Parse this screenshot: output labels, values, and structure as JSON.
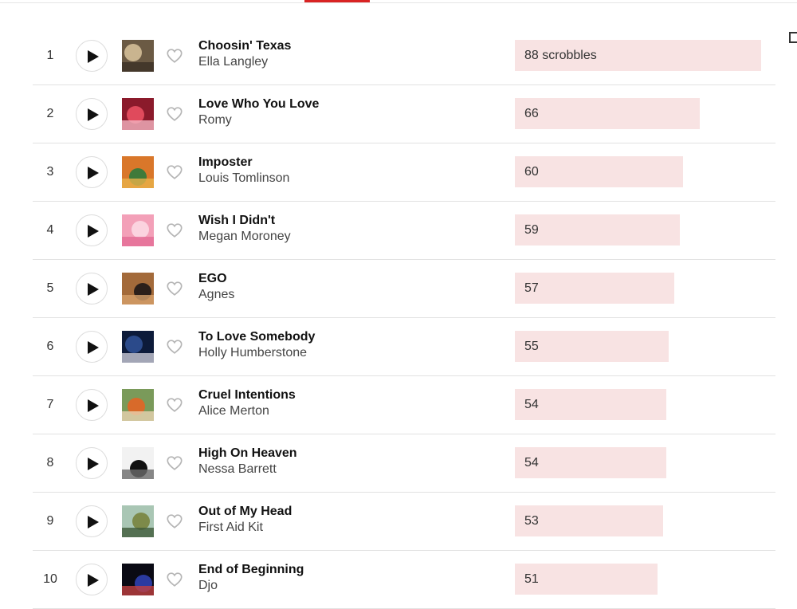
{
  "chart_data": {
    "type": "table",
    "columns": [
      "rank",
      "track",
      "artist",
      "scrobbles"
    ],
    "unit_label": "scrobbles",
    "max": 88,
    "rows": [
      {
        "rank": "1",
        "track": "Choosin' Texas",
        "artist": "Ella Langley",
        "scrobbles": 88,
        "label": "88 scrobbles"
      },
      {
        "rank": "2",
        "track": "Love Who You Love",
        "artist": "Romy",
        "scrobbles": 66,
        "label": "66"
      },
      {
        "rank": "3",
        "track": "Imposter",
        "artist": "Louis Tomlinson",
        "scrobbles": 60,
        "label": "60"
      },
      {
        "rank": "4",
        "track": "Wish I Didn't",
        "artist": "Megan Moroney",
        "scrobbles": 59,
        "label": "59"
      },
      {
        "rank": "5",
        "track": "EGO",
        "artist": "Agnes",
        "scrobbles": 57,
        "label": "57"
      },
      {
        "rank": "6",
        "track": "To Love Somebody",
        "artist": "Holly Humberstone",
        "scrobbles": 55,
        "label": "55"
      },
      {
        "rank": "7",
        "track": "Cruel Intentions",
        "artist": "Alice Merton",
        "scrobbles": 54,
        "label": "54"
      },
      {
        "rank": "8",
        "track": "High On Heaven",
        "artist": "Nessa Barrett",
        "scrobbles": 54,
        "label": "54"
      },
      {
        "rank": "9",
        "track": "Out of My Head",
        "artist": "First Aid Kit",
        "scrobbles": 53,
        "label": "53"
      },
      {
        "rank": "10",
        "track": "End of Beginning",
        "artist": "Djo",
        "scrobbles": 51,
        "label": "51"
      }
    ]
  },
  "colors": {
    "bar_fill": "#f8e3e3",
    "accent": "#d92323",
    "divider": "#e2e2e2"
  },
  "icons": {
    "play": "play-icon",
    "love": "heart-outline-icon",
    "artwork": "album-art"
  },
  "artwork_palettes": [
    [
      "#6b5a44",
      "#c9b48f",
      "#3b2f25"
    ],
    [
      "#8b1a2b",
      "#e04a5c",
      "#f2b3c0"
    ],
    [
      "#d9772a",
      "#3f7a3a",
      "#e8b24a"
    ],
    [
      "#f3a0b8",
      "#fbd3df",
      "#e36c95"
    ],
    [
      "#a36a3a",
      "#2b1f1a",
      "#d6a06a"
    ],
    [
      "#0d1b3a",
      "#2b4a8a",
      "#c9c9d6"
    ],
    [
      "#7a9a5a",
      "#d86a2a",
      "#e8d2b0"
    ],
    [
      "#f2f2f2",
      "#111111",
      "#6a6a6a"
    ],
    [
      "#a9c6b4",
      "#7d8a4a",
      "#3e5a3a"
    ],
    [
      "#0a0a14",
      "#2a3aa0",
      "#c04040"
    ]
  ]
}
